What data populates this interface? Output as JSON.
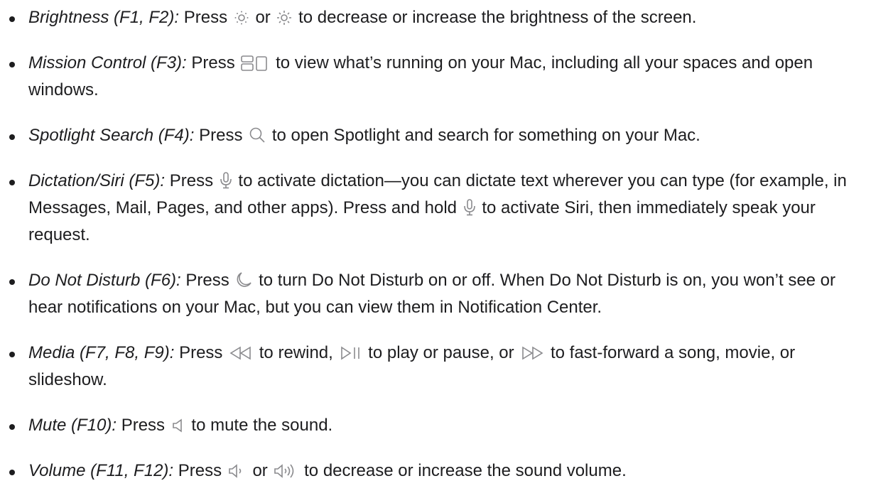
{
  "items": [
    {
      "term": "Brightness (F1, F2):",
      "press": "Press",
      "icon1": "brightness-down-icon",
      "mid1": "or",
      "icon2": "brightness-up-icon",
      "rest": "to decrease or increase the brightness of the screen."
    },
    {
      "term": "Mission Control (F3):",
      "press": "Press",
      "icon1": "mission-control-icon",
      "rest": "to view what’s running on your Mac, including all your spaces and open windows."
    },
    {
      "term": "Spotlight Search (F4):",
      "press": "Press",
      "icon1": "search-icon",
      "rest": "to open Spotlight and search for something on your Mac."
    },
    {
      "term": "Dictation/Siri (F5):",
      "press": "Press",
      "icon1": "microphone-icon",
      "mid1": "to activate dictation—you can dictate text wherever you can type (for example, in Messages, Mail, Pages, and other apps). Press and hold",
      "icon2": "microphone-icon",
      "rest": "to activate Siri, then immediately speak your request."
    },
    {
      "term": "Do Not Disturb (F6):",
      "press": "Press",
      "icon1": "moon-icon",
      "rest": "to turn Do Not Disturb on or off. When Do Not Disturb is on, you won’t see or hear notifications on your Mac, but you can view them in Notification Center."
    },
    {
      "term": "Media (F7, F8, F9):",
      "press": "Press",
      "icon1": "rewind-icon",
      "mid1": "to rewind,",
      "icon2": "play-pause-icon",
      "mid2": "to play or pause, or",
      "icon3": "fast-forward-icon",
      "rest": "to fast-forward a song, movie, or slideshow."
    },
    {
      "term": "Mute (F10):",
      "press": "Press",
      "icon1": "mute-icon",
      "rest": "to mute the sound."
    },
    {
      "term": "Volume (F11, F12):",
      "press": "Press",
      "icon1": "volume-down-icon",
      "mid1": "or",
      "icon2": "volume-up-icon",
      "rest": "to decrease or increase the sound volume."
    }
  ]
}
